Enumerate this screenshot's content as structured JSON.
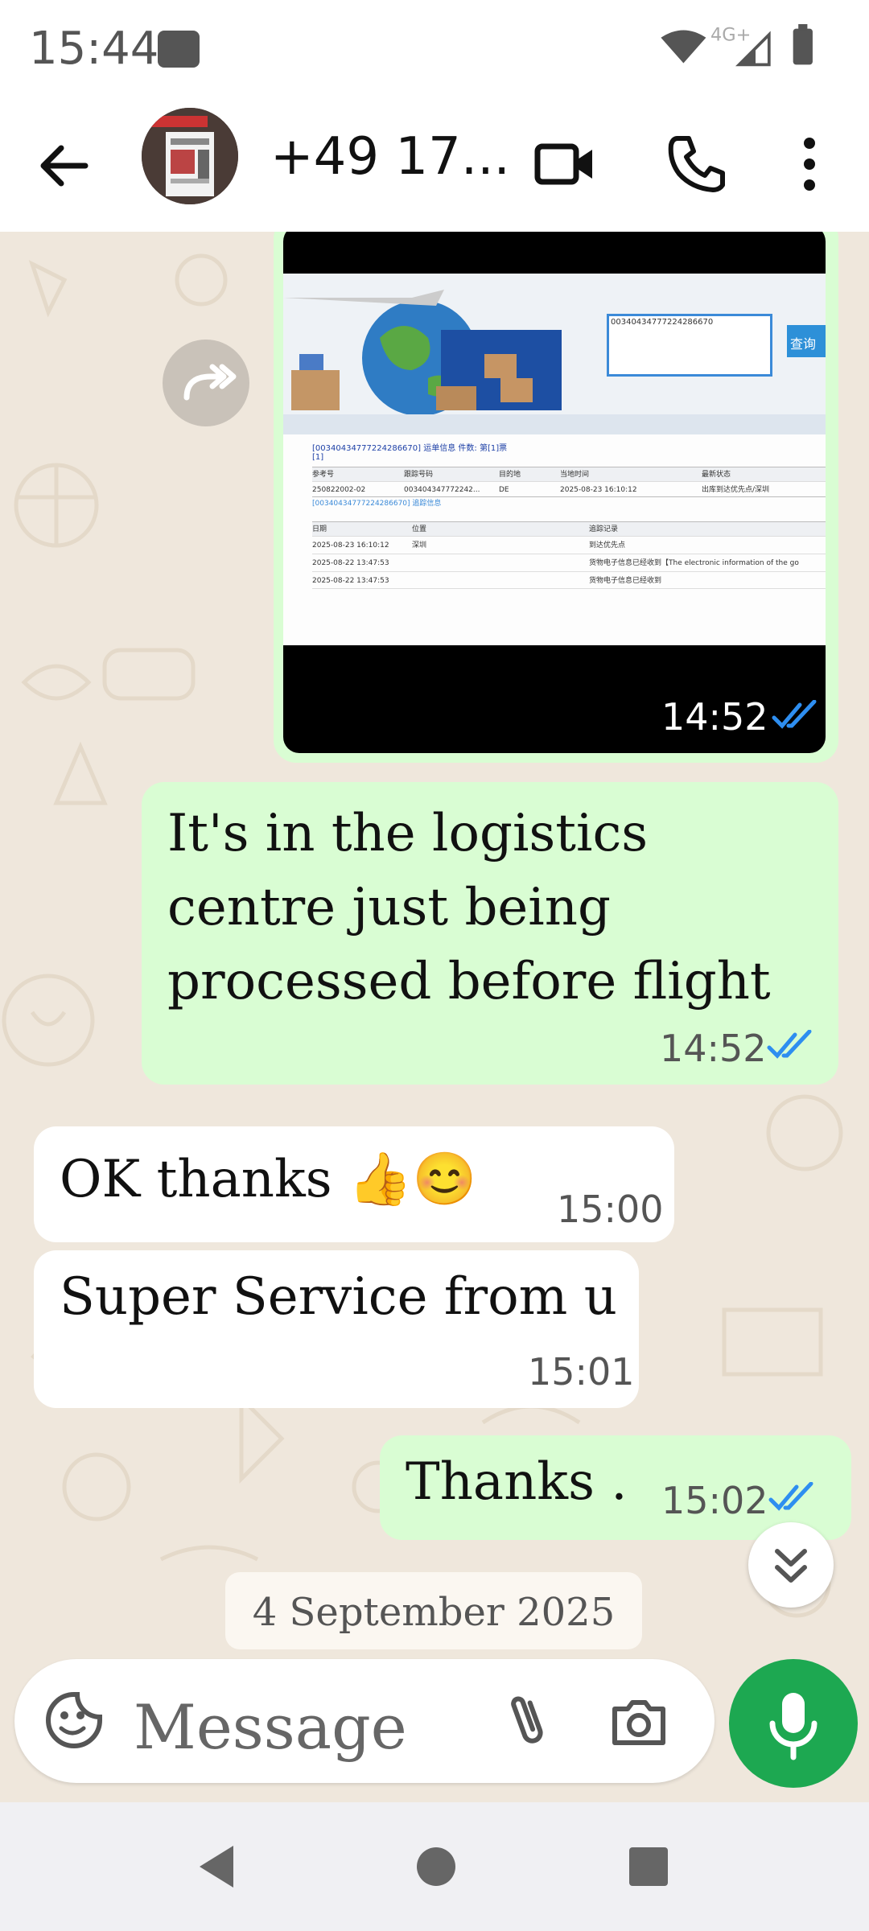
{
  "status_bar": {
    "time": "15:44",
    "network": "4G+"
  },
  "header": {
    "title": "+49 17..."
  },
  "image_message": {
    "time": "14:52",
    "screenshot": {
      "tracking_number": "00340434777224286670",
      "query_button": "查询",
      "header_line": "[00340434777224286670] 运单信息  件数: 第[1]票",
      "header_line2": "[1]",
      "cols1": [
        "参考号",
        "跟踪号码",
        "目的地",
        "当地时间",
        "最新状态"
      ],
      "row1": [
        "250822002-02",
        "003404347772242...",
        "DE",
        "2025-08-23 16:10:12",
        "出库到达优先点/深圳"
      ],
      "trace_title": "[00340434777224286670] 追踪信息",
      "cols2": [
        "日期",
        "位置",
        "追踪记录"
      ],
      "trace_rows": [
        [
          "2025-08-23 16:10:12",
          "深圳",
          "到达优先点"
        ],
        [
          "2025-08-22 13:47:53",
          "",
          "货物电子信息已经收到【The electronic information of the go"
        ],
        [
          "2025-08-22 13:47:53",
          "",
          "货物电子信息已经收到"
        ]
      ]
    }
  },
  "messages": [
    {
      "direction": "out",
      "text_lines": [
        "It's in the logistics",
        "centre just being",
        "processed before flight"
      ],
      "time": "14:52"
    },
    {
      "direction": "in",
      "text": "OK thanks 👍😊",
      "time": "15:00"
    },
    {
      "direction": "in",
      "text": "Super Service from u",
      "time": "15:01"
    },
    {
      "direction": "out",
      "text": "Thanks .",
      "time": "15:02"
    }
  ],
  "date_divider": "4 September 2025",
  "composer": {
    "placeholder": "Message"
  },
  "colors": {
    "outgoing": "#d9fdd3",
    "incoming": "#ffffff",
    "mic": "#1da851",
    "read_ticks": "#2e8ef0"
  },
  "icons": [
    "back-arrow-icon",
    "video-call-icon",
    "phone-icon",
    "more-vert-icon",
    "forward-icon",
    "double-chevron-down-icon",
    "sticker-icon",
    "attach-icon",
    "camera-icon",
    "mic-icon"
  ]
}
